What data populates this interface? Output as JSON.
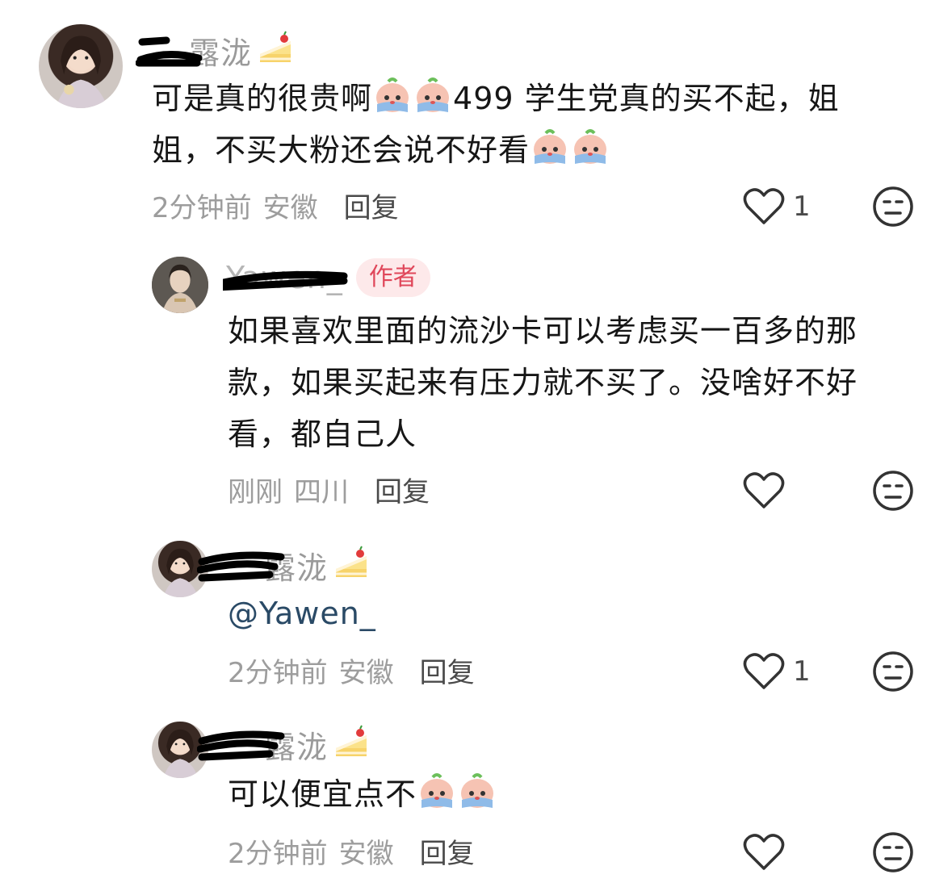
{
  "comments": [
    {
      "username": "露泷",
      "text_a": "可是真的很贵啊",
      "text_b": "499 学生党真的买不起，姐姐，不买大粉还会说不好看",
      "time": "2分钟前",
      "location": "安徽",
      "reply": "回复",
      "likes": "1"
    },
    {
      "username": "Yawen_",
      "badge": "作者",
      "text": "如果喜欢里面的流沙卡可以考虑买一百多的那款，如果买起来有压力就不买了。没啥好不好看，都自己人",
      "time": "刚刚",
      "location": "四川",
      "reply": "回复"
    },
    {
      "username": "露泷",
      "text": "@Yawen_",
      "time": "2分钟前",
      "location": "安徽",
      "reply": "回复",
      "likes": "1"
    },
    {
      "username": "露泷",
      "text": "可以便宜点不",
      "time": "2分钟前",
      "location": "安徽",
      "reply": "回复"
    }
  ],
  "colors": {
    "author_badge_bg": "#fde9ea",
    "author_badge_text": "#e0475a",
    "meta": "#9d9d9d"
  }
}
